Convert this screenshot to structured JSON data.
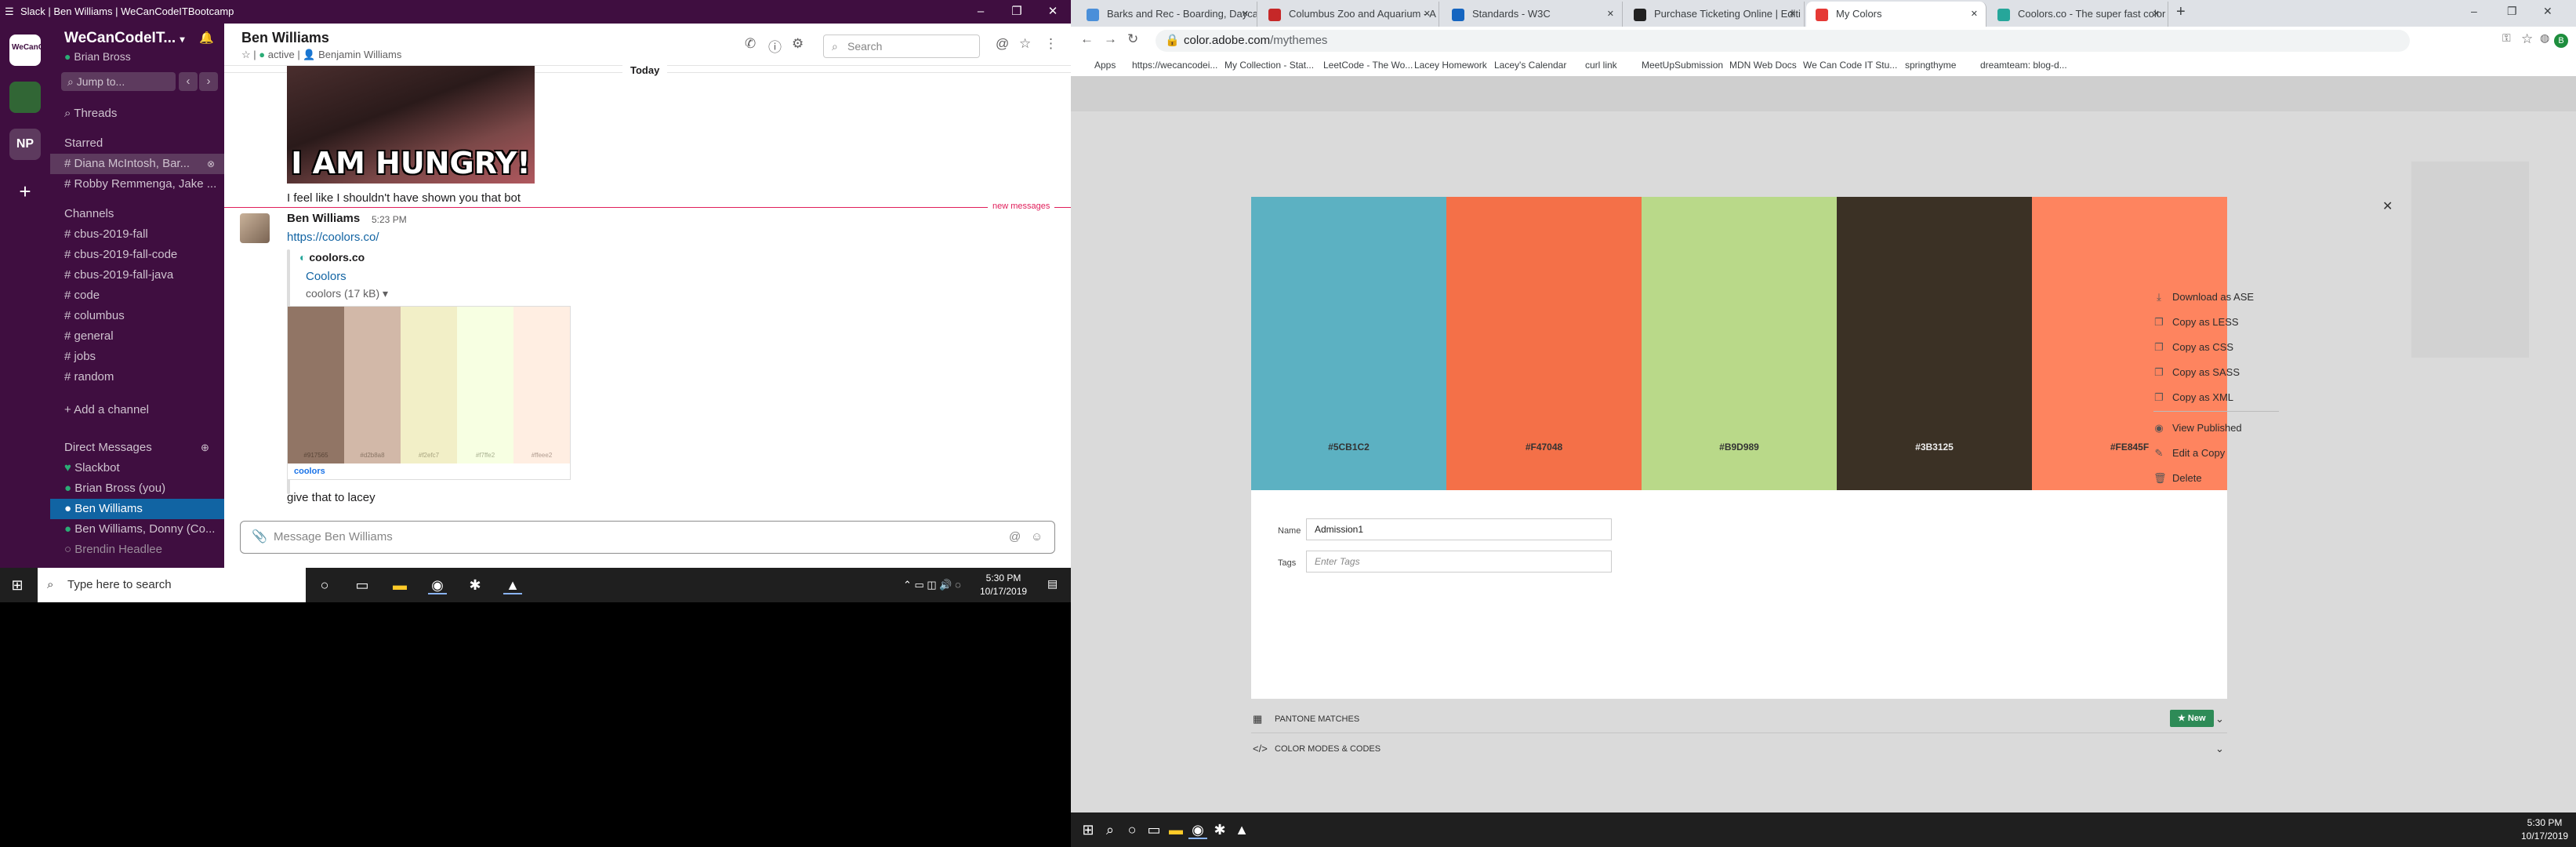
{
  "slack": {
    "window_title": "Slack | Ben Williams | WeCanCodeITBootcamp",
    "workspaces": [
      "WeCanCodeIT",
      "NP"
    ],
    "workspace_name": "WeCanCodeIT...",
    "user": "Brian Bross",
    "jump_to": "Jump to...",
    "threads": "Threads",
    "starred_header": "Starred",
    "starred": [
      "Diana McIntosh, Bar...",
      "Robby Remmenga, Jake ..."
    ],
    "channels_header": "Channels",
    "channels": [
      "cbus-2019-fall",
      "cbus-2019-fall-code",
      "cbus-2019-fall-java",
      "code",
      "columbus",
      "general",
      "jobs",
      "random"
    ],
    "add_channel": "+ Add a channel",
    "dm_header": "Direct Messages",
    "dms": [
      "Slackbot",
      "Brian Bross  (you)",
      "Ben Williams",
      "Ben Williams, Donny (Co...",
      "Brendin Headlee"
    ],
    "channel_title": "Ben Williams",
    "status": "active",
    "member": "Benjamin Williams",
    "search_placeholder": "Search",
    "day_divider": "Today",
    "gif_text": "I AM HUNGRY!",
    "msg1": "I feel like I shouldn't have shown you that bot",
    "new_messages": "new messages",
    "sender": "Ben Williams",
    "time": "5:23 PM",
    "link": "https://coolors.co/",
    "unfurl_site": "coolors.co",
    "unfurl_title": "Coolors",
    "file_label": "coolors (17 kB) ▾",
    "preview_hexes": [
      "#917565",
      "#d2b8a8",
      "#f2efc7",
      "#f7ffe2",
      "#ffeee2"
    ],
    "preview_brand": "coolors",
    "msg2": "give that to lacey",
    "input_placeholder": "Message Ben Williams",
    "taskbar_search": "Type here to search",
    "clock_time": "5:30 PM",
    "clock_date": "10/17/2019"
  },
  "chrome": {
    "tabs": [
      "Barks and Rec - Boarding, Dayca",
      "Columbus Zoo and Aquarium - A",
      "Standards - W3C",
      "Purchase Ticketing Online | Editi",
      "My Colors",
      "Coolors.co - The super fast color"
    ],
    "active_tab": 4,
    "tab_colors": [
      "#4a8fd9",
      "#c62828",
      "#1565c0",
      "#212121",
      "#e53935",
      "#26a69a"
    ],
    "url_host": "color.adobe.com",
    "url_path": "/mythemes",
    "bookmarks": [
      "Apps",
      "https://wecancodei...",
      "My Collection - Stat...",
      "LeetCode - The Wo...",
      "Lacey Homework",
      "Lacey's Calendar",
      "curl link",
      "MeetUpSubmission",
      "MDN Web Docs",
      "We Can Code IT Stu...",
      "springthyme",
      "dreamteam: blog-d..."
    ],
    "swatches": [
      {
        "hex": "#5CB1C2",
        "color": "#5cb1c2"
      },
      {
        "hex": "#F47048",
        "color": "#f47048"
      },
      {
        "hex": "#B9D989",
        "color": "#b9d989"
      },
      {
        "hex": "#3B3125",
        "color": "#3b3125"
      },
      {
        "hex": "#FE845F",
        "color": "#fe845f"
      }
    ],
    "menu": [
      "Download as ASE",
      "Copy as LESS",
      "Copy as CSS",
      "Copy as SASS",
      "Copy as XML",
      "View Published",
      "Edit a Copy",
      "Delete"
    ],
    "name_label": "Name",
    "name_value": "Admission1",
    "tags_label": "Tags",
    "tags_placeholder": "Enter Tags",
    "pantone_label": "PANTONE MATCHES",
    "new_badge": "New",
    "modes_label": "COLOR MODES & CODES",
    "clock_time": "5:30 PM",
    "clock_date": "10/17/2019"
  }
}
